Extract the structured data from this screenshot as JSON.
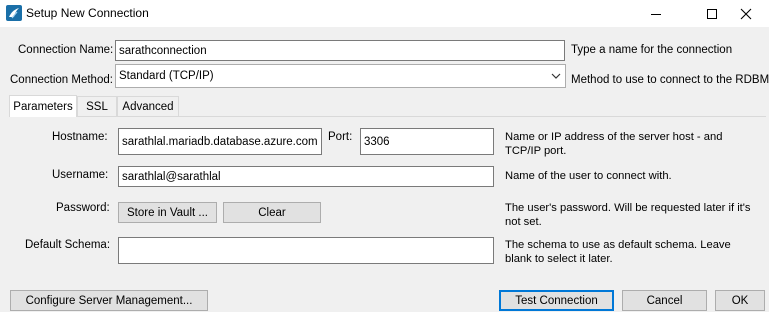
{
  "window": {
    "title": "Setup New Connection",
    "controls": [
      "minimize",
      "maximize",
      "close"
    ]
  },
  "connection_name": {
    "label": "Connection Name:",
    "value": "sarathconnection",
    "help": "Type a name for the connection"
  },
  "connection_method": {
    "label": "Connection Method:",
    "selected": "Standard (TCP/IP)",
    "help": "Method to use to connect to the RDBMS"
  },
  "tabs": [
    {
      "label": "Parameters",
      "active": true
    },
    {
      "label": "SSL",
      "active": false
    },
    {
      "label": "Advanced",
      "active": false
    }
  ],
  "parameters": {
    "hostname": {
      "label": "Hostname:",
      "value": "sarathlal.mariadb.database.azure.com",
      "help": "Name or IP address of the server host - and TCP/IP port."
    },
    "port": {
      "label": "Port:",
      "value": "3306"
    },
    "username": {
      "label": "Username:",
      "value": "sarathlal@sarathlal",
      "help": "Name of the user to connect with."
    },
    "password": {
      "label": "Password:",
      "store_button": "Store in Vault ...",
      "clear_button": "Clear",
      "help": "The user's password. Will be requested later if it's not set."
    },
    "default_schema": {
      "label": "Default Schema:",
      "value": "",
      "help": "The schema to use as default schema. Leave blank to select it later."
    }
  },
  "footer": {
    "configure_button": "Configure Server Management...",
    "test_button": "Test Connection",
    "cancel_button": "Cancel",
    "ok_button": "OK"
  },
  "colors": {
    "dialog_bg": "#f0f0f0",
    "default_button_border": "#0078d7",
    "app_icon": "#1a6fa8"
  }
}
